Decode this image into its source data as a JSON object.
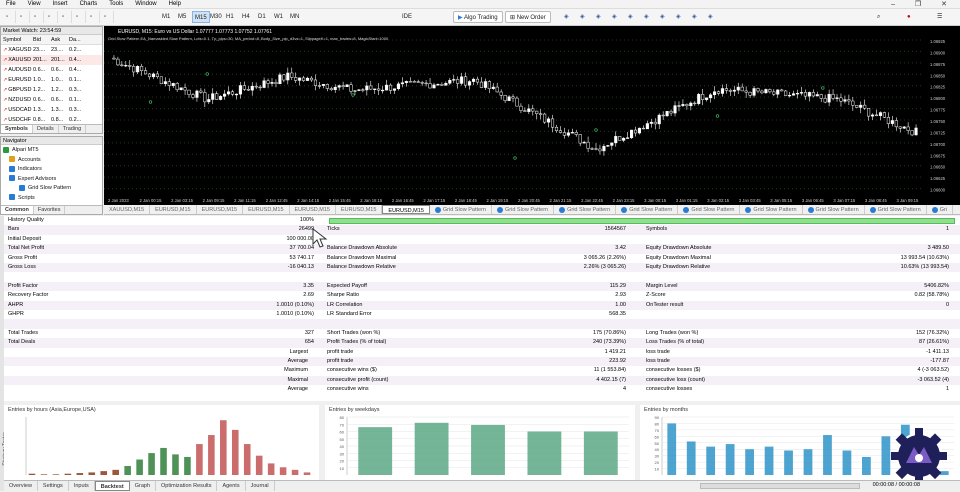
{
  "menu": [
    "File",
    "View",
    "Insert",
    "Charts",
    "Tools",
    "Window",
    "Help"
  ],
  "toolbar": {
    "timeframes": [
      "M1",
      "M5",
      "M15",
      "M30",
      "H1",
      "H4",
      "D1",
      "W1",
      "MN"
    ],
    "active_tf": "M15",
    "ide": "IDE",
    "algo": "Algo Trading",
    "new_order": "New Order"
  },
  "market_watch": {
    "title": "Market Watch: 23:54:59",
    "headers": [
      "Symbol",
      "Bid",
      "Ask",
      "Da..."
    ],
    "rows": [
      {
        "symbol": "XAGUSD",
        "bid": "23....",
        "ask": "23....",
        "d": "0.2..."
      },
      {
        "symbol": "XAUUSD",
        "bid": "201...",
        "ask": "201...",
        "d": "0.4..."
      },
      {
        "symbol": "AUDUSD",
        "bid": "0.6...",
        "ask": "0.6...",
        "d": "0.4..."
      },
      {
        "symbol": "EURUSD",
        "bid": "1.0...",
        "ask": "1.0...",
        "d": "0.1..."
      },
      {
        "symbol": "GBPUSD",
        "bid": "1.2...",
        "ask": "1.2...",
        "d": "0.3..."
      },
      {
        "symbol": "NZDUSD",
        "bid": "0.6...",
        "ask": "0.6...",
        "d": "0.1..."
      },
      {
        "symbol": "USDCAD",
        "bid": "1.3...",
        "ask": "1.3...",
        "d": "0.3..."
      },
      {
        "symbol": "USDCHF",
        "bid": "0.8...",
        "ask": "0.8...",
        "d": "0.2..."
      }
    ],
    "tabs": [
      "Symbols",
      "Details",
      "Trading"
    ]
  },
  "navigator": {
    "title": "Navigator",
    "items": [
      "Alpari MT5",
      "Accounts",
      "Indicators",
      "Expert Advisors",
      "Grid Slow Pattern",
      "Scripts"
    ],
    "tabs": [
      "Common",
      "Favorites"
    ]
  },
  "chart": {
    "header": "EURUSD, M15: Euro vs US Dollar 1.07777 1.07773 1.07752 1.07761",
    "subheader": "Grid Slow Pattern EA_Namaskied Slow Pattern, Lots=0.1, Tp_pips=30, MA_period=8, Body_Size_pip_d3vs=1, SlippageK=1, max_trades=8, MagicStart=1000",
    "prices": [
      "1.06925",
      "1.06900",
      "1.06875",
      "1.06850",
      "1.06825",
      "1.06800",
      "1.06775",
      "1.06750",
      "1.06725",
      "1.06700",
      "1.06675",
      "1.06650",
      "1.06625",
      "1.06600"
    ],
    "times": [
      "2 Jan 2023",
      "2 Jan 00:15",
      "2 Jan 03:15",
      "2 Jan 09:15",
      "2 Jan 11:15",
      "2 Jan 12:45",
      "2 Jan 14:15",
      "2 Jan 15:45",
      "2 Jan 16:15",
      "2 Jan 16:45",
      "2 Jan 17:15",
      "2 Jan 18:45",
      "2 Jan 19:15",
      "2 Jan 20:45",
      "2 Jan 21:15",
      "2 Jan 22:45",
      "2 Jan 23:15",
      "3 Jan 00:15",
      "3 Jan 01:15",
      "3 Jan 02:15",
      "3 Jan 03:45",
      "3 Jan 05:15",
      "3 Jan 06:45",
      "3 Jan 07:15",
      "3 Jan 08:45",
      "3 Jan 09:15"
    ],
    "up_color": "#ffffff",
    "down_color": "#ffffff",
    "bg_color": "#000000",
    "grid_color": "#1e3a1e"
  },
  "chart_tabs": [
    "XAUUSD,M15",
    "EURUSD,M15",
    "EURUSD,M15",
    "EURUSD,M15",
    "EURUSD,M15",
    "EURUSD,M15",
    "EURUSD,M15",
    "Grid Slow Pattern",
    "Grid Slow Pattern",
    "Grid Slow Pattern",
    "Grid Slow Pattern",
    "Grid Slow Pattern",
    "Grid Slow Pattern",
    "Grid Slow Pattern",
    "Grid Slow Pattern",
    "Gri"
  ],
  "report": {
    "rows": [
      {
        "l1": "History Quality",
        "v1": "100%",
        "l2": "",
        "v2": "",
        "l3": "",
        "v3": ""
      },
      {
        "l1": "Bars",
        "v1": "26499",
        "l2": "Ticks",
        "v2": "1564567",
        "l3": "Symbols",
        "v3": "1"
      },
      {
        "l1": "Initial Deposit",
        "v1": "100 000.00",
        "l2": "",
        "v2": "",
        "l3": "",
        "v3": ""
      },
      {
        "l1": "Total Net Profit",
        "v1": "37 700.04",
        "l2": "Balance Drawdown Absolute",
        "v2": "3.42",
        "l3": "Equity Drawdown Absolute",
        "v3": "3 489.50"
      },
      {
        "l1": "Gross Profit",
        "v1": "53 740.17",
        "l2": "Balance Drawdown Maximal",
        "v2": "3 065.26 (2.26%)",
        "l3": "Equity Drawdown Maximal",
        "v3": "13 993.54 (10.63%)"
      },
      {
        "l1": "Gross Loss",
        "v1": "-16 040.13",
        "l2": "Balance Drawdown Relative",
        "v2": "2.26% (3 065.26)",
        "l3": "Equity Drawdown Relative",
        "v3": "10.63% (13 993.54)"
      },
      {
        "l1": "",
        "v1": "",
        "l2": "",
        "v2": "",
        "l3": "",
        "v3": ""
      },
      {
        "l1": "Profit Factor",
        "v1": "3.35",
        "l2": "Expected Payoff",
        "v2": "115.29",
        "l3": "Margin Level",
        "v3": "5406.82%"
      },
      {
        "l1": "Recovery Factor",
        "v1": "2.69",
        "l2": "Sharpe Ratio",
        "v2": "2.93",
        "l3": "Z-Score",
        "v3": "0.82 (58.78%)"
      },
      {
        "l1": "AHPR",
        "v1": "1.0010 (0.10%)",
        "l2": "LR Correlation",
        "v2": "1.00",
        "l3": "OnTester result",
        "v3": "0"
      },
      {
        "l1": "GHPR",
        "v1": "1.0010 (0.10%)",
        "l2": "LR Standard Error",
        "v2": "568.35",
        "l3": "",
        "v3": ""
      },
      {
        "l1": "",
        "v1": "",
        "l2": "",
        "v2": "",
        "l3": "",
        "v3": ""
      },
      {
        "l1": "Total Trades",
        "v1": "327",
        "l2": "Short Trades (won %)",
        "v2": "175 (70.86%)",
        "l3": "Long Trades (won %)",
        "v3": "152 (76.32%)"
      },
      {
        "l1": "Total Deals",
        "v1": "654",
        "l2": "Profit Trades (% of total)",
        "v2": "240 (73.39%)",
        "l3": "Loss Trades (% of total)",
        "v3": "87 (26.61%)"
      },
      {
        "l1": "Largest",
        "v1": "",
        "l2": "profit trade",
        "v2": "1 419.21",
        "l3": "loss trade",
        "v3": "-1 411.13",
        "sub": true
      },
      {
        "l1": "Average",
        "v1": "",
        "l2": "profit trade",
        "v2": "223.92",
        "l3": "loss trade",
        "v3": "-177.87",
        "sub": true
      },
      {
        "l1": "Maximum",
        "v1": "",
        "l2": "consecutive wins ($)",
        "v2": "11 (1 553.84)",
        "l3": "consecutive losses ($)",
        "v3": "4 (-3 063.52)",
        "sub": true
      },
      {
        "l1": "Maximal",
        "v1": "",
        "l2": "consecutive profit (count)",
        "v2": "4 402.15 (7)",
        "l3": "consecutive loss (count)",
        "v3": "-3 063.52 (4)",
        "sub": true
      },
      {
        "l1": "Average",
        "v1": "",
        "l2": "consecutive wins",
        "v2": "4",
        "l3": "consecutive losses",
        "v3": "1",
        "sub": true
      }
    ]
  },
  "histograms": [
    {
      "title": "Entries by hours (Asia,Europe,USA)",
      "yticks": [],
      "values": [
        2,
        1,
        1,
        2,
        3,
        4,
        6,
        8,
        14,
        24,
        34,
        42,
        32,
        28,
        48,
        62,
        85,
        70,
        48,
        30,
        18,
        12,
        8,
        4
      ],
      "colors": [
        "#8a3a16",
        "#8a3a16",
        "#8a3a16",
        "#8a3a16",
        "#8a3a16",
        "#8a3a16",
        "#8a3a16",
        "#8a3a16",
        "#2f7f3a",
        "#2f7f3a",
        "#2f7f3a",
        "#2f7f3a",
        "#2f7f3a",
        "#2f7f3a",
        "#c25454",
        "#c25454",
        "#c25454",
        "#c25454",
        "#c25454",
        "#c25454",
        "#c25454",
        "#c25454",
        "#c25454",
        "#c25454"
      ],
      "max": 90
    },
    {
      "title": "Entries by weekdays",
      "yticks": [
        "80",
        "70",
        "60",
        "50",
        "40",
        "30",
        "20",
        "10"
      ],
      "values": [
        66,
        72,
        69,
        60,
        60
      ],
      "colors": [
        "#5aa884"
      ],
      "max": 80
    },
    {
      "title": "Entries by months",
      "yticks": [
        "90",
        "80",
        "70",
        "60",
        "50",
        "40",
        "30",
        "20",
        "10"
      ],
      "values": [
        80,
        52,
        44,
        48,
        40,
        44,
        38,
        40,
        62,
        38,
        28,
        60,
        78,
        20,
        6
      ],
      "colors": [
        "#2e94c8"
      ],
      "max": 90
    }
  ],
  "bottom_tabs": [
    "Overview",
    "Settings",
    "Inputs",
    "Backtest",
    "Graph",
    "Optimization Results",
    "Agents",
    "Journal"
  ],
  "bottom_active": "Backtest",
  "status_time": "00:00:08 / 00:00:08",
  "side_label": "Strategy Tester"
}
